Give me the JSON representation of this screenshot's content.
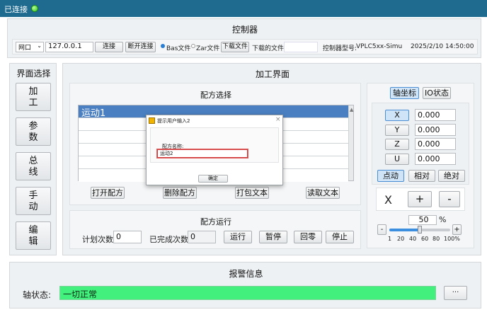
{
  "status": {
    "connected": "已连接"
  },
  "controller": {
    "title": "控制器",
    "port_type": "网口",
    "ip": "127.0.0.1",
    "connect": "连接",
    "disconnect": "断开连接",
    "bas_file": "Bas文件",
    "zar_file": "Zar文件",
    "download_file": "下载文件",
    "downloaded_label": "下载的文件:",
    "downloaded_value": "",
    "model_label": "控制器型号:",
    "model_value": "VPLC5xx-Simu",
    "datetime": "2025/2/10 14:50:00"
  },
  "nav": {
    "title": "界面选择",
    "items": [
      "加\n工",
      "参\n数",
      "总\n线",
      "手\n动",
      "编\n辑"
    ]
  },
  "main": {
    "title": "加工界面"
  },
  "recipe": {
    "title": "配方选择",
    "rows": [
      "运动1",
      "",
      "",
      "",
      "",
      ""
    ],
    "open": "打开配方",
    "delete": "删除配方",
    "pack": "打包文本",
    "read": "读取文本"
  },
  "dialog": {
    "title": "提示用户输入2",
    "label": "配方名称:",
    "value": "运动2",
    "ok": "确定",
    "close": "×"
  },
  "run": {
    "title": "配方运行",
    "plan_label": "计划次数",
    "plan_value": "0",
    "done_label": "已完成次数",
    "done_value": "0",
    "run": "运行",
    "pause": "暂停",
    "home": "回零",
    "stop": "停止"
  },
  "axis": {
    "tab_coord": "轴坐标",
    "tab_io": "IO状态",
    "axes": [
      {
        "name": "X",
        "value": "0.000"
      },
      {
        "name": "Y",
        "value": "0.000"
      },
      {
        "name": "Z",
        "value": "0.000"
      },
      {
        "name": "U",
        "value": "0.000"
      }
    ],
    "mode_jog": "点动",
    "mode_rel": "相对",
    "mode_abs": "绝对",
    "jog_axis": "X",
    "plus": "+",
    "minus": "-",
    "speed_value": "50",
    "speed_unit": "%",
    "speed_fraction": 0.5,
    "ticks": [
      "1",
      "20",
      "40",
      "60",
      "80",
      "100%"
    ]
  },
  "alarm": {
    "title": "报警信息",
    "axis_status_label": "轴状态:",
    "axis_status_value": "一切正常",
    "more": "···"
  },
  "colors": {
    "titlebar": "#1e6b8f",
    "alarm_ok": "#42f07e",
    "selected_row": "#4a7fc1"
  }
}
